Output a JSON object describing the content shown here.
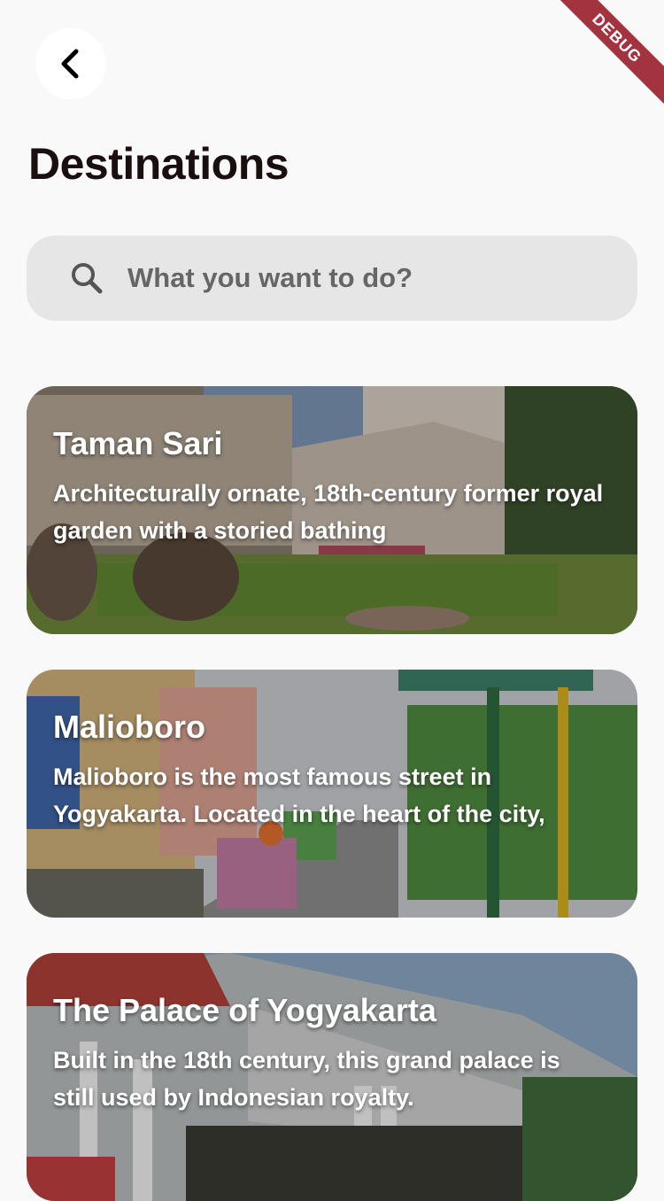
{
  "header": {
    "title": "Destinations"
  },
  "debug_banner": "DEBUG",
  "search": {
    "placeholder": "What you want to do?"
  },
  "destinations": [
    {
      "title": "Taman Sari",
      "description": "Architecturally ornate, 18th-century former royal garden with a storied bathing"
    },
    {
      "title": "Malioboro",
      "description": "Malioboro is the most famous street in Yogyakarta. Located in the heart of the city,"
    },
    {
      "title": "The Palace of Yogyakarta",
      "description": "Built in the 18th century, this grand palace is still used by Indonesian royalty."
    }
  ],
  "colors": {
    "background": "#f9f9f9",
    "search_bg": "#e6e6e6",
    "title_text": "#1a0f0f",
    "debug_ribbon": "#a3333f"
  }
}
